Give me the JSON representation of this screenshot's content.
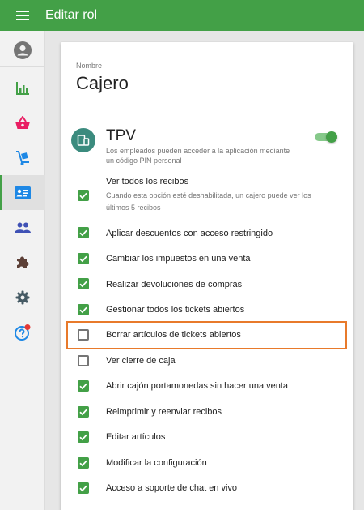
{
  "appbar": {
    "title": "Editar rol"
  },
  "sidebar": {
    "items": [
      {
        "name": "account-icon",
        "color": "#757575"
      },
      {
        "name": "bar-chart-icon",
        "color": "#43a047"
      },
      {
        "name": "basket-icon",
        "color": "#e91e63"
      },
      {
        "name": "hand-truck-icon",
        "color": "#1e88e5"
      },
      {
        "name": "employee-card-icon",
        "color": "#1e88e5",
        "active": true
      },
      {
        "name": "people-icon",
        "color": "#3f51b5"
      },
      {
        "name": "puzzle-icon",
        "color": "#5d4037"
      },
      {
        "name": "gear-icon",
        "color": "#455a64"
      },
      {
        "name": "help-icon",
        "color": "#1e88e5",
        "badge_color": "#e53935"
      }
    ]
  },
  "role": {
    "name_label": "Nombre",
    "name_value": "Cajero"
  },
  "tpv": {
    "title": "TPV",
    "description": "Los empleados pueden acceder a la aplicación mediante un código PIN personal",
    "enabled": true,
    "accent": "#43a047"
  },
  "permissions": [
    {
      "label": "Ver todos los recibos",
      "description": "Cuando esta opción esté deshabilitada, un cajero puede ver los últimos 5 recibos",
      "checked": true
    },
    {
      "label": "Aplicar descuentos con acceso restringido",
      "checked": true
    },
    {
      "label": "Cambiar los impuestos en una venta",
      "checked": true
    },
    {
      "label": "Realizar devoluciones de compras",
      "checked": true
    },
    {
      "label": "Gestionar todos los tickets abiertos",
      "checked": true
    },
    {
      "label": "Borrar artículos de tickets abiertos",
      "checked": false,
      "highlighted": true
    },
    {
      "label": "Ver cierre de caja",
      "checked": false
    },
    {
      "label": "Abrir cajón portamonedas sin hacer una venta",
      "checked": true
    },
    {
      "label": "Reimprimir y reenviar recibos",
      "checked": true
    },
    {
      "label": "Editar artículos",
      "checked": true
    },
    {
      "label": "Modificar la configuración",
      "checked": true
    },
    {
      "label": "Acceso a soporte de chat en vivo",
      "checked": true
    }
  ]
}
